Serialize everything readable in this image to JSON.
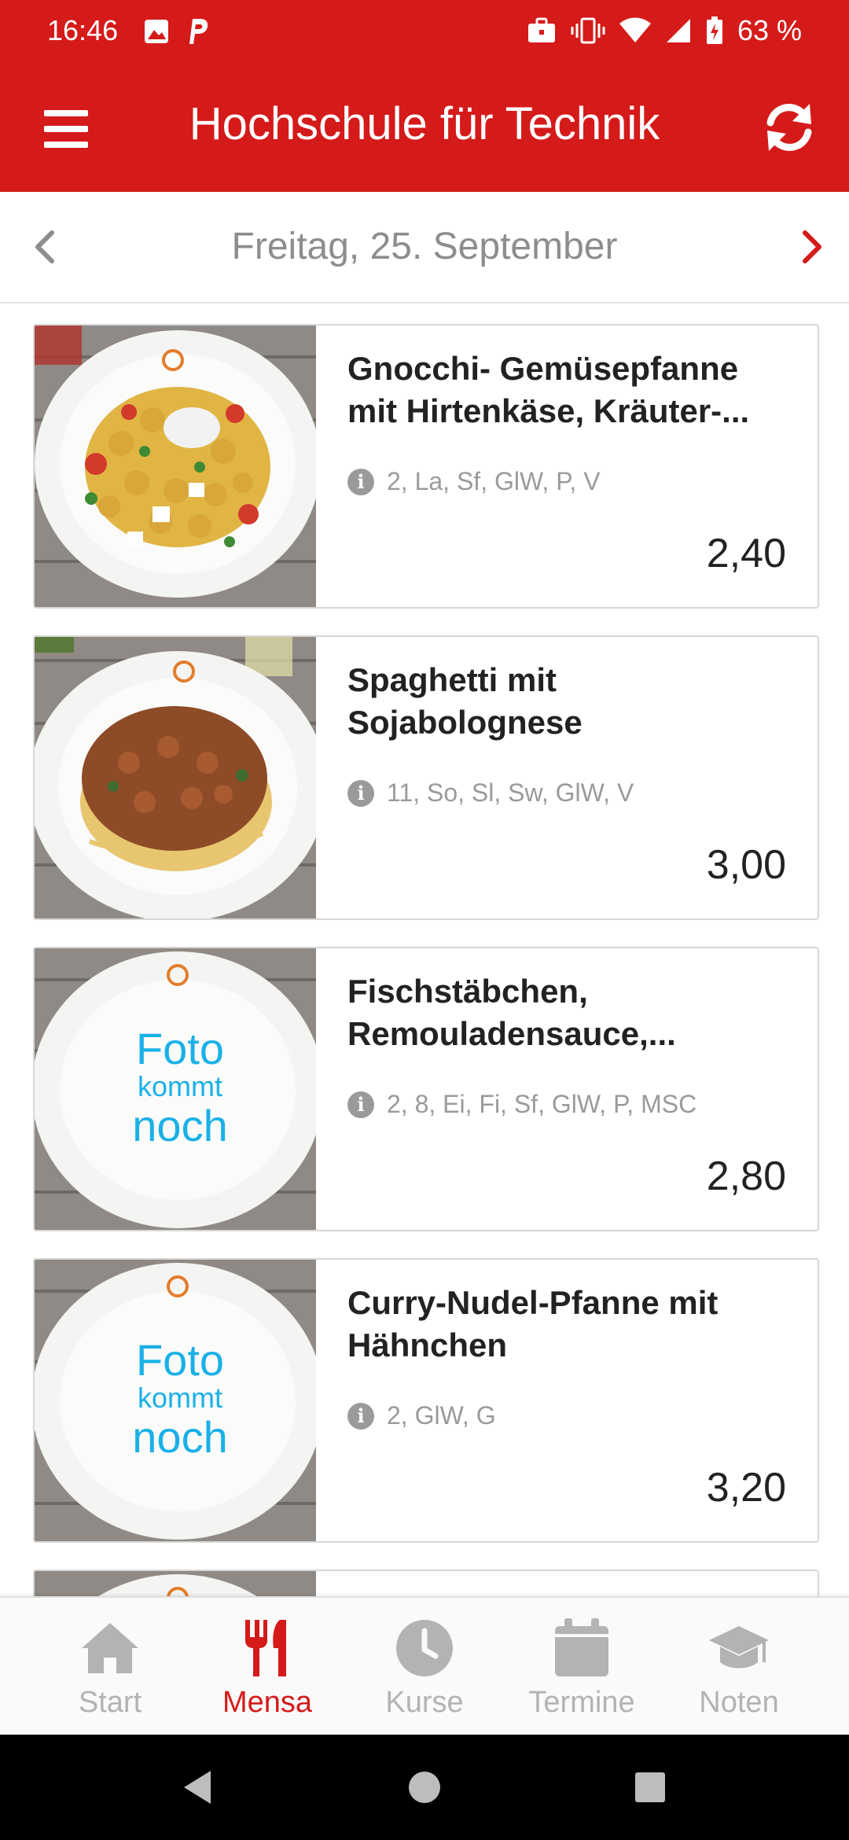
{
  "status_bar": {
    "time": "16:46",
    "battery_text": "63 %",
    "left_icons": [
      "image-icon",
      "parking-icon"
    ],
    "right_icons": [
      "briefcase-icon",
      "vibrate-icon",
      "wifi-icon",
      "signal-icon",
      "battery-icon"
    ]
  },
  "app_bar": {
    "title": "Hochschule für Technik",
    "menu_icon": "menu-icon",
    "refresh_icon": "refresh-icon",
    "color": "#d51a1a"
  },
  "date_nav": {
    "date": "Freitag, 25. September",
    "prev_icon": "chevron-left-icon",
    "next_icon": "chevron-right-icon"
  },
  "meals": [
    {
      "name": "Gnocchi- Gemüsepfanne mit Hirtenkäse, Kräuter-...",
      "allergens": "2, La, Sf, GlW, P, V",
      "price": "2,40",
      "image": "gnocchi"
    },
    {
      "name": "Spaghetti mit Sojabolognese",
      "allergens": "11, So, Sl, Sw, GlW, V",
      "price": "3,00",
      "image": "spaghetti"
    },
    {
      "name": "Fischstäbchen, Remouladensauce,...",
      "allergens": "2, 8, Ei, Fi, Sf, GlW, P, MSC",
      "price": "2,80",
      "image": "placeholder",
      "placeholder_lines": [
        "Foto",
        "kommt",
        "noch"
      ]
    },
    {
      "name": "Curry-Nudel-Pfanne mit Hähnchen",
      "allergens": "2, GlW, G",
      "price": "3,20",
      "image": "placeholder",
      "placeholder_lines": [
        "Foto",
        "kommt",
        "noch"
      ]
    }
  ],
  "bottom_nav": {
    "items": [
      {
        "label": "Start",
        "icon": "home-icon"
      },
      {
        "label": "Mensa",
        "icon": "cutlery-icon",
        "active": true
      },
      {
        "label": "Kurse",
        "icon": "clock-icon"
      },
      {
        "label": "Termine",
        "icon": "calendar-icon"
      },
      {
        "label": "Noten",
        "icon": "graduation-cap-icon"
      }
    ],
    "active_color": "#d51a1a",
    "inactive_color": "#b3b3b3"
  }
}
